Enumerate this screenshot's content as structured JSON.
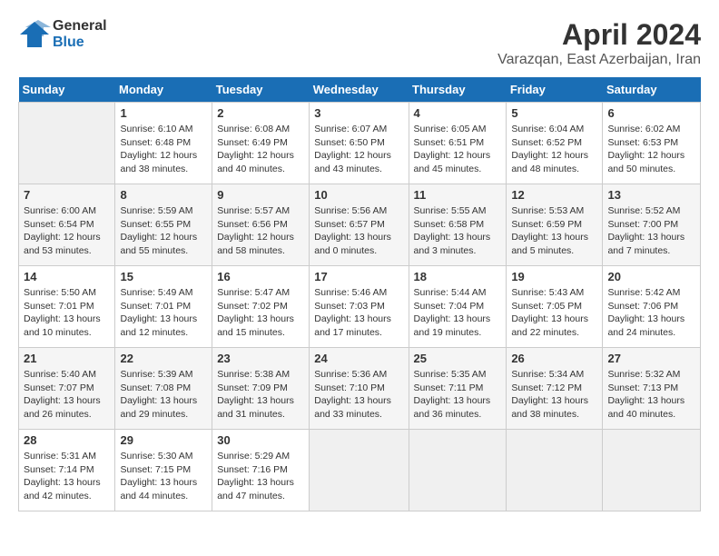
{
  "header": {
    "logo_general": "General",
    "logo_blue": "Blue",
    "title": "April 2024",
    "subtitle": "Varazqan, East Azerbaijan, Iran"
  },
  "calendar": {
    "days_of_week": [
      "Sunday",
      "Monday",
      "Tuesday",
      "Wednesday",
      "Thursday",
      "Friday",
      "Saturday"
    ],
    "weeks": [
      [
        {
          "day": "",
          "info": ""
        },
        {
          "day": "1",
          "info": "Sunrise: 6:10 AM\nSunset: 6:48 PM\nDaylight: 12 hours\nand 38 minutes."
        },
        {
          "day": "2",
          "info": "Sunrise: 6:08 AM\nSunset: 6:49 PM\nDaylight: 12 hours\nand 40 minutes."
        },
        {
          "day": "3",
          "info": "Sunrise: 6:07 AM\nSunset: 6:50 PM\nDaylight: 12 hours\nand 43 minutes."
        },
        {
          "day": "4",
          "info": "Sunrise: 6:05 AM\nSunset: 6:51 PM\nDaylight: 12 hours\nand 45 minutes."
        },
        {
          "day": "5",
          "info": "Sunrise: 6:04 AM\nSunset: 6:52 PM\nDaylight: 12 hours\nand 48 minutes."
        },
        {
          "day": "6",
          "info": "Sunrise: 6:02 AM\nSunset: 6:53 PM\nDaylight: 12 hours\nand 50 minutes."
        }
      ],
      [
        {
          "day": "7",
          "info": "Sunrise: 6:00 AM\nSunset: 6:54 PM\nDaylight: 12 hours\nand 53 minutes."
        },
        {
          "day": "8",
          "info": "Sunrise: 5:59 AM\nSunset: 6:55 PM\nDaylight: 12 hours\nand 55 minutes."
        },
        {
          "day": "9",
          "info": "Sunrise: 5:57 AM\nSunset: 6:56 PM\nDaylight: 12 hours\nand 58 minutes."
        },
        {
          "day": "10",
          "info": "Sunrise: 5:56 AM\nSunset: 6:57 PM\nDaylight: 13 hours\nand 0 minutes."
        },
        {
          "day": "11",
          "info": "Sunrise: 5:55 AM\nSunset: 6:58 PM\nDaylight: 13 hours\nand 3 minutes."
        },
        {
          "day": "12",
          "info": "Sunrise: 5:53 AM\nSunset: 6:59 PM\nDaylight: 13 hours\nand 5 minutes."
        },
        {
          "day": "13",
          "info": "Sunrise: 5:52 AM\nSunset: 7:00 PM\nDaylight: 13 hours\nand 7 minutes."
        }
      ],
      [
        {
          "day": "14",
          "info": "Sunrise: 5:50 AM\nSunset: 7:01 PM\nDaylight: 13 hours\nand 10 minutes."
        },
        {
          "day": "15",
          "info": "Sunrise: 5:49 AM\nSunset: 7:01 PM\nDaylight: 13 hours\nand 12 minutes."
        },
        {
          "day": "16",
          "info": "Sunrise: 5:47 AM\nSunset: 7:02 PM\nDaylight: 13 hours\nand 15 minutes."
        },
        {
          "day": "17",
          "info": "Sunrise: 5:46 AM\nSunset: 7:03 PM\nDaylight: 13 hours\nand 17 minutes."
        },
        {
          "day": "18",
          "info": "Sunrise: 5:44 AM\nSunset: 7:04 PM\nDaylight: 13 hours\nand 19 minutes."
        },
        {
          "day": "19",
          "info": "Sunrise: 5:43 AM\nSunset: 7:05 PM\nDaylight: 13 hours\nand 22 minutes."
        },
        {
          "day": "20",
          "info": "Sunrise: 5:42 AM\nSunset: 7:06 PM\nDaylight: 13 hours\nand 24 minutes."
        }
      ],
      [
        {
          "day": "21",
          "info": "Sunrise: 5:40 AM\nSunset: 7:07 PM\nDaylight: 13 hours\nand 26 minutes."
        },
        {
          "day": "22",
          "info": "Sunrise: 5:39 AM\nSunset: 7:08 PM\nDaylight: 13 hours\nand 29 minutes."
        },
        {
          "day": "23",
          "info": "Sunrise: 5:38 AM\nSunset: 7:09 PM\nDaylight: 13 hours\nand 31 minutes."
        },
        {
          "day": "24",
          "info": "Sunrise: 5:36 AM\nSunset: 7:10 PM\nDaylight: 13 hours\nand 33 minutes."
        },
        {
          "day": "25",
          "info": "Sunrise: 5:35 AM\nSunset: 7:11 PM\nDaylight: 13 hours\nand 36 minutes."
        },
        {
          "day": "26",
          "info": "Sunrise: 5:34 AM\nSunset: 7:12 PM\nDaylight: 13 hours\nand 38 minutes."
        },
        {
          "day": "27",
          "info": "Sunrise: 5:32 AM\nSunset: 7:13 PM\nDaylight: 13 hours\nand 40 minutes."
        }
      ],
      [
        {
          "day": "28",
          "info": "Sunrise: 5:31 AM\nSunset: 7:14 PM\nDaylight: 13 hours\nand 42 minutes."
        },
        {
          "day": "29",
          "info": "Sunrise: 5:30 AM\nSunset: 7:15 PM\nDaylight: 13 hours\nand 44 minutes."
        },
        {
          "day": "30",
          "info": "Sunrise: 5:29 AM\nSunset: 7:16 PM\nDaylight: 13 hours\nand 47 minutes."
        },
        {
          "day": "",
          "info": ""
        },
        {
          "day": "",
          "info": ""
        },
        {
          "day": "",
          "info": ""
        },
        {
          "day": "",
          "info": ""
        }
      ]
    ]
  }
}
